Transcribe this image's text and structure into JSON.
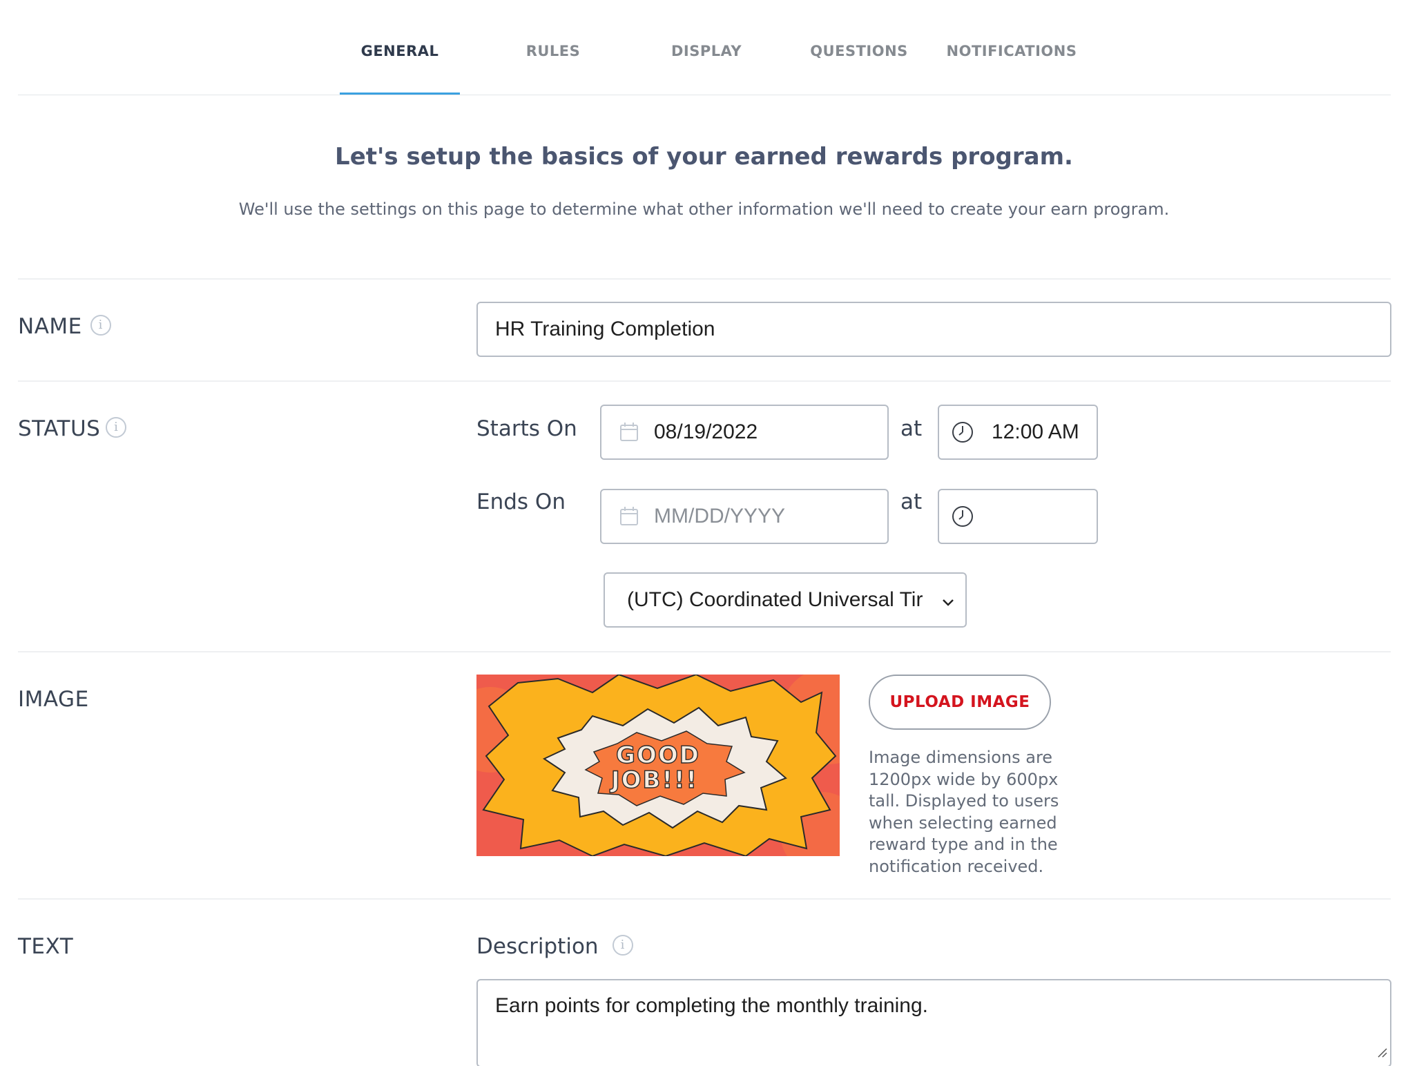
{
  "tabs": [
    {
      "label": "GENERAL",
      "active": true
    },
    {
      "label": "RULES",
      "active": false
    },
    {
      "label": "DISPLAY",
      "active": false
    },
    {
      "label": "QUESTIONS",
      "active": false
    },
    {
      "label": "NOTIFICATIONS",
      "active": false
    }
  ],
  "intro": {
    "title": "Let's setup the basics of your earned rewards program.",
    "subtitle": "We'll use the settings on this page to determine what other information we'll need to create your earn program."
  },
  "name_section": {
    "label": "NAME",
    "value": "HR Training Completion"
  },
  "status_section": {
    "label": "STATUS",
    "starts_label": "Starts On",
    "starts_date": "08/19/2022",
    "starts_at": "at",
    "starts_time": "12:00 AM",
    "ends_label": "Ends On",
    "ends_date_placeholder": "MM/DD/YYYY",
    "ends_at": "at",
    "ends_time": "",
    "timezone": "(UTC) Coordinated Universal Tir"
  },
  "image_section": {
    "label": "IMAGE",
    "image_text_line1": "GOOD",
    "image_text_line2": "JOB!!!",
    "upload_button": "UPLOAD IMAGE",
    "help_text": "Image dimensions are 1200px wide by 600px tall. Displayed to users when selecting earned reward type and in the notification received."
  },
  "text_section": {
    "label": "TEXT",
    "description_label": "Description",
    "description_value": "Earn points for completing the monthly training."
  },
  "icons": {
    "info": "info-icon",
    "calendar": "calendar-icon",
    "clock": "clock-icon",
    "chevron": "chevron-down-icon"
  },
  "colors": {
    "tab_active_underline": "#3ba1e0",
    "upload_text": "#d4141e",
    "image_background": "#ef5b4c",
    "image_burst": "#fbb21d"
  }
}
